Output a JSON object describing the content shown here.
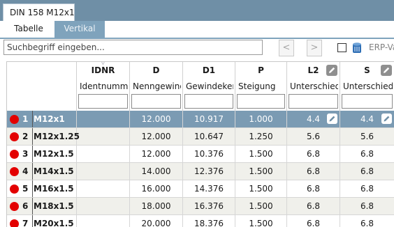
{
  "window": {
    "doc_tab": "DIN 158 M12x1"
  },
  "tabs": [
    {
      "label": "Tabelle"
    },
    {
      "label": "Vertikal"
    }
  ],
  "search": {
    "placeholder": "Suchbegriff eingeben..."
  },
  "nav": {
    "prev": "<",
    "next": ">"
  },
  "erp": {
    "label": "ERP-Va",
    "checked": false
  },
  "columns": [
    {
      "key": "IDNR",
      "title": "IDNR",
      "desc": "Identnummer"
    },
    {
      "key": "D",
      "title": "D",
      "desc": "Nenngewinde"
    },
    {
      "key": "D1",
      "title": "D1",
      "desc": "Gewindekern"
    },
    {
      "key": "P",
      "title": "P",
      "desc": "Steigung"
    },
    {
      "key": "L2",
      "title": "L2",
      "desc": "Unterschied"
    },
    {
      "key": "S",
      "title": "S",
      "desc": "Unterschied"
    }
  ],
  "rows": [
    {
      "num": "1",
      "name": "M12x1",
      "IDNR": "",
      "D": "12.000",
      "D1": "10.917",
      "P": "1.000",
      "L2": "4.4",
      "S": "4.4"
    },
    {
      "num": "2",
      "name": "M12x1.25",
      "IDNR": "",
      "D": "12.000",
      "D1": "10.647",
      "P": "1.250",
      "L2": "5.6",
      "S": "5.6"
    },
    {
      "num": "3",
      "name": "M12x1.5",
      "IDNR": "",
      "D": "12.000",
      "D1": "10.376",
      "P": "1.500",
      "L2": "6.8",
      "S": "6.8"
    },
    {
      "num": "4",
      "name": "M14x1.5",
      "IDNR": "",
      "D": "14.000",
      "D1": "12.376",
      "P": "1.500",
      "L2": "6.8",
      "S": "6.8"
    },
    {
      "num": "5",
      "name": "M16x1.5",
      "IDNR": "",
      "D": "16.000",
      "D1": "14.376",
      "P": "1.500",
      "L2": "6.8",
      "S": "6.8"
    },
    {
      "num": "6",
      "name": "M18x1.5",
      "IDNR": "",
      "D": "18.000",
      "D1": "16.376",
      "P": "1.500",
      "L2": "6.8",
      "S": "6.8"
    },
    {
      "num": "7",
      "name": "M20x1.5",
      "IDNR": "",
      "D": "20.000",
      "D1": "18.376",
      "P": "1.500",
      "L2": "6.8",
      "S": "6.8"
    }
  ],
  "selected_row": 0,
  "colors": {
    "titlebar": "#6f8fa6",
    "selected": "#7b9bb3",
    "status_dot": "#e30000",
    "alt_row": "#f0f0eb"
  }
}
